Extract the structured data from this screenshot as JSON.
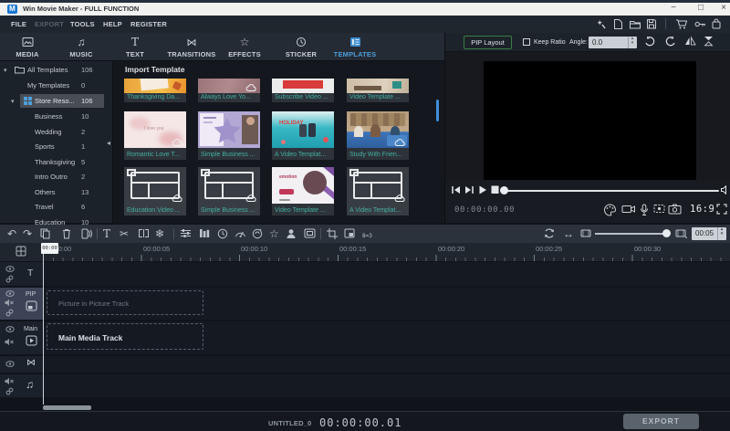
{
  "titlebar": {
    "logo": "M",
    "title": "Win Movie Maker - FULL FUNCTION",
    "minimize": "−",
    "maximize": "□",
    "close": "×"
  },
  "menubar": {
    "items": [
      "FILE",
      "EXPORT",
      "TOOLS",
      "HELP",
      "REGISTER"
    ]
  },
  "tabs": {
    "items": [
      {
        "label": "MEDIA"
      },
      {
        "label": "MUSIC"
      },
      {
        "label": "TEXT"
      },
      {
        "label": "TRANSITIONS"
      },
      {
        "label": "EFFECTS"
      },
      {
        "label": "STICKER"
      },
      {
        "label": "TEMPLATES"
      }
    ],
    "active": "TEMPLATES",
    "accent_color": "#4e9ed9"
  },
  "sidebar": {
    "items": [
      {
        "label": "All Templates",
        "count": "106"
      },
      {
        "label": "My Templates",
        "count": "0"
      },
      {
        "label": "Store Reso...",
        "count": "106"
      },
      {
        "label": "Business",
        "count": "10"
      },
      {
        "label": "Wedding",
        "count": "2"
      },
      {
        "label": "Sports",
        "count": "1"
      },
      {
        "label": "Thanksgiving",
        "count": "5"
      },
      {
        "label": "Intro Outro",
        "count": "2"
      },
      {
        "label": "Others",
        "count": "13"
      },
      {
        "label": "Travel",
        "count": "6"
      },
      {
        "label": "Education",
        "count": "10"
      }
    ],
    "selected": "Store Reso..."
  },
  "templates": {
    "header": "Import Template",
    "label_color": "#43b0a4",
    "cards": [
      {
        "label": "Thanksgiving Da..."
      },
      {
        "label": "Always Love Yo..."
      },
      {
        "label": "Subscribe Video ..."
      },
      {
        "label": "Video Template ..."
      },
      {
        "label": "Romantic Love T..."
      },
      {
        "label": "Simple Business ..."
      },
      {
        "label": "A Video Templat..."
      },
      {
        "label": "Study With Frien..."
      },
      {
        "label": "Education Video ..."
      },
      {
        "label": "Simple Business ..."
      },
      {
        "label": "Video Template ..."
      },
      {
        "label": "A Video Templat..."
      }
    ]
  },
  "pip_controls": {
    "layout_button": "PIP Layout",
    "keep_ratio": "Keep Ratio",
    "angle_label": "Angle:",
    "angle_value": "0.0",
    "button_border": "#3f8c4a"
  },
  "preview": {
    "timecode": "00:00:00.00",
    "aspect_ratio": "16:9"
  },
  "timeline": {
    "ruler": {
      "labels": [
        "00:00:00",
        "00:00:05",
        "00:00:10",
        "00:00:15",
        "00:00:20",
        "00:00:25",
        "00:00:30"
      ],
      "playhead_label": "00:00"
    },
    "toolbar": {
      "frame_badge": "8=3",
      "zoom_duration": "00:05"
    },
    "tracks": {
      "text_label": "T",
      "pip_label": "PIP",
      "main_label": "Main",
      "transition_glyph": "⋈",
      "audio_glyph": "♫",
      "pip_placeholder": "Picture in Picture Track",
      "main_placeholder": "Main Media Track"
    }
  },
  "statusbar": {
    "project_name": "UNTITLED_0",
    "timecode": "00:00:00.01",
    "export_label": "EXPORT"
  }
}
